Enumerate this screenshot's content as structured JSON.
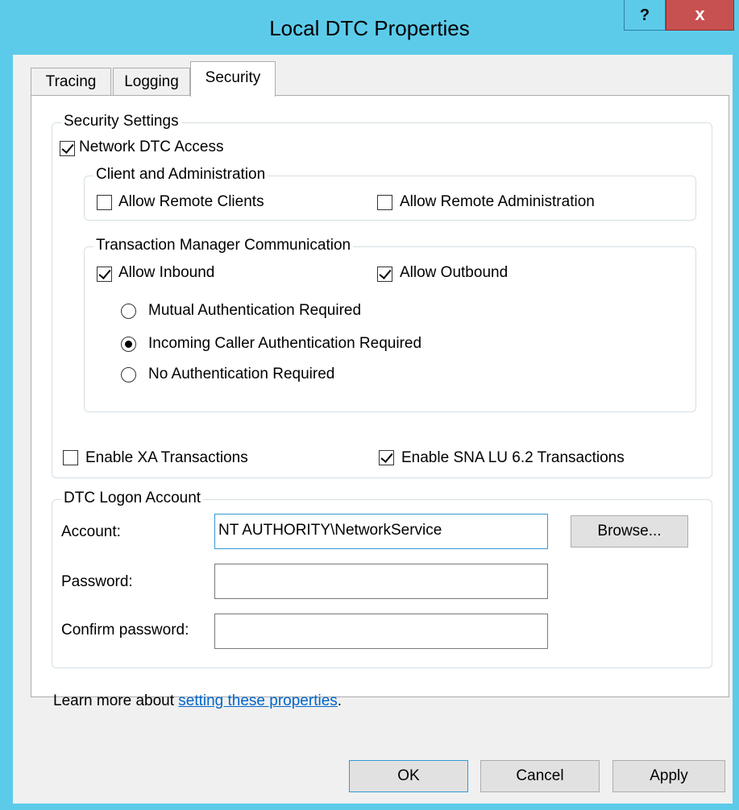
{
  "window": {
    "title": "Local DTC Properties",
    "help_label": "?",
    "close_label": "x"
  },
  "tabs": [
    {
      "label": "Tracing",
      "active": false
    },
    {
      "label": "Logging",
      "active": false
    },
    {
      "label": "Security",
      "active": true
    }
  ],
  "security_settings": {
    "legend": "Security Settings",
    "network_dtc_access": {
      "label": "Network DTC Access",
      "checked": true
    },
    "client_admin": {
      "legend": "Client and Administration",
      "allow_remote_clients": {
        "label": "Allow Remote Clients",
        "checked": false
      },
      "allow_remote_admin": {
        "label": "Allow Remote Administration",
        "checked": false
      }
    },
    "tm_communication": {
      "legend": "Transaction Manager Communication",
      "allow_inbound": {
        "label": "Allow Inbound",
        "checked": true
      },
      "allow_outbound": {
        "label": "Allow Outbound",
        "checked": true
      },
      "auth_options": [
        {
          "label": "Mutual Authentication Required",
          "selected": false
        },
        {
          "label": "Incoming Caller Authentication Required",
          "selected": true
        },
        {
          "label": "No Authentication Required",
          "selected": false
        }
      ]
    },
    "enable_xa": {
      "label": "Enable XA Transactions",
      "checked": false
    },
    "enable_sna": {
      "label": "Enable SNA LU 6.2 Transactions",
      "checked": true
    }
  },
  "logon_account": {
    "legend": "DTC Logon Account",
    "account_label": "Account:",
    "account_value": "NT AUTHORITY\\NetworkService",
    "browse_label": "Browse...",
    "password_label": "Password:",
    "password_value": "",
    "confirm_label": "Confirm password:",
    "confirm_value": ""
  },
  "learn_more": {
    "prefix": "Learn more about ",
    "link": "setting these properties",
    "suffix": "."
  },
  "buttons": {
    "ok": "OK",
    "cancel": "Cancel",
    "apply": "Apply"
  },
  "colors": {
    "title_bar": "#5ccbea",
    "close_button": "#c75050",
    "link": "#0066cc",
    "focus_border": "#3399d6"
  }
}
